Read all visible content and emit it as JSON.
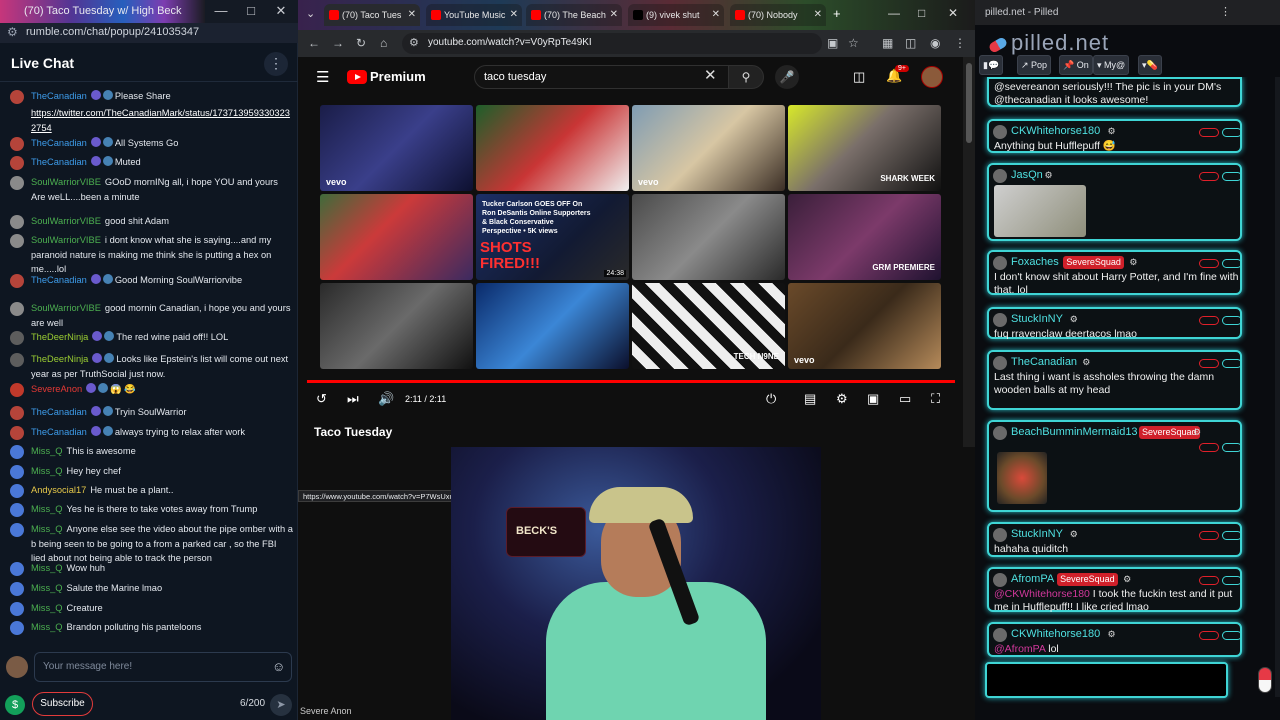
{
  "left_window": {
    "title": "(70) Taco Tuesday w/ High Beck",
    "url": "rumble.com/chat/popup/241035347",
    "header": "Live Chat",
    "messages": [
      {
        "user": "TheCanadian",
        "color": "#3d9be9",
        "text": "Please Share"
      },
      {
        "user": "",
        "color": "#ffffff",
        "text": "https://twitter.com/TheCanadianMark/status/1737139593303232754"
      },
      {
        "user": "TheCanadian",
        "color": "#3d9be9",
        "text": "All Systems Go"
      },
      {
        "user": "TheCanadian",
        "color": "#3d9be9",
        "text": "Muted"
      },
      {
        "user": "SoulWarriorVIBE",
        "color": "#4caf50",
        "text": "GOoD mornINg all, i hope YOU and yours Are weLL....been a minute"
      },
      {
        "user": "SoulWarriorVIBE",
        "color": "#4caf50",
        "text": "good shit Adam"
      },
      {
        "user": "SoulWarriorVIBE",
        "color": "#4caf50",
        "text": "i dont know what she is saying....and my paranoid nature is making me think she is putting a hex on me.....lol"
      },
      {
        "user": "TheCanadian",
        "color": "#3d9be9",
        "text": "Good Morning SoulWarriorvibe"
      },
      {
        "user": "SoulWarriorVIBE",
        "color": "#4caf50",
        "text": "good mornin Canadian, i hope you and yours are well"
      },
      {
        "user": "TheDeerNinja",
        "color": "#9acd32",
        "text": "The red wine paid off!! LOL"
      },
      {
        "user": "TheDeerNinja",
        "color": "#9acd32",
        "text": "Looks like Epstein's list will come out next year as per TruthSocial just now."
      },
      {
        "user": "SevereAnon",
        "color": "#e53935",
        "text": "😱 😂"
      },
      {
        "user": "TheCanadian",
        "color": "#3d9be9",
        "text": "Tryin SoulWarrior"
      },
      {
        "user": "TheCanadian",
        "color": "#3d9be9",
        "text": "always trying to relax after work"
      },
      {
        "user": "Miss_Q",
        "color": "#4caf50",
        "text": "This is awesome"
      },
      {
        "user": "Miss_Q",
        "color": "#4caf50",
        "text": "Hey hey chef"
      },
      {
        "user": "Andysocial17",
        "color": "#e6c84a",
        "text": "He must be a plant.."
      },
      {
        "user": "Miss_Q",
        "color": "#4caf50",
        "text": "Yes he is there to take votes away from Trump"
      },
      {
        "user": "Miss_Q",
        "color": "#4caf50",
        "text": "Anyone else see the video about the pipe omber with a b being seen to be going to a from a parked car , so the FBI lied about not being able to track the person"
      },
      {
        "user": "Miss_Q",
        "color": "#4caf50",
        "text": "Wow huh"
      },
      {
        "user": "Miss_Q",
        "color": "#4caf50",
        "text": "Salute the Marine lmao"
      },
      {
        "user": "Miss_Q",
        "color": "#4caf50",
        "text": "Creature"
      },
      {
        "user": "Miss_Q",
        "color": "#4caf50",
        "text": "Brandon polluting his panteloons"
      }
    ],
    "input_placeholder": "Your message here!",
    "subscribe": "Subscribe",
    "char_count": "6/200"
  },
  "browser": {
    "tabs": [
      {
        "label": "(70) Taco Tues",
        "fav": "#ff0000"
      },
      {
        "label": "YouTube Music",
        "fav": "#ff0000"
      },
      {
        "label": "(70) The Beach",
        "fav": "#ff0000"
      },
      {
        "label": "(9) vivek shut",
        "fav": "#000000"
      },
      {
        "label": "(70) Nobody",
        "fav": "#ff0000"
      }
    ],
    "url": "youtube.com/watch?v=V0yRpTe49KI",
    "yt": {
      "brand": "Premium",
      "search_query": "taco tuesday",
      "notif_count": "9+",
      "thumbs": [
        {
          "label": "vevo",
          "bg": "linear-gradient(135deg,#1a1d48,#3a3f8a 50%,#0d1030)"
        },
        {
          "label": "",
          "bg": "linear-gradient(135deg,#1d5f2a,#c93535 50%,#f0f0f0)"
        },
        {
          "label": "vevo",
          "bg": "linear-gradient(135deg,#7f9cb3,#d7c6a3 50%,#3b2e25)"
        },
        {
          "label": "SHARK WEEK",
          "bg": "linear-gradient(135deg,#d7e82a,#7a6f6a 45%,#111)"
        },
        {
          "label": "",
          "bg": "linear-gradient(135deg,#3f6b3a,#cb3a3a 40%,#3b2a60)"
        },
        {
          "label": "Tucker Carlson GOES OFF On Ron DeSantis Online Supporters & Black Conservative Perspective • 5K views",
          "title2": "SHOTS FIRED!!!",
          "dur": "24:38",
          "bg": "linear-gradient(135deg,#1c2f66,#121a33 60%,#2a2a2a)"
        },
        {
          "label": "",
          "bg": "linear-gradient(135deg,#4a4a4a,#8a8a8a 50%,#2a2a2a)"
        },
        {
          "label": "GRM PREMIERE",
          "bg": "linear-gradient(135deg,#3a1f3a,#7c3a6a 50%,#1f1230)"
        },
        {
          "label": "",
          "bg": "linear-gradient(135deg,#2a2a2a,#6a6a6a 50%,#111)"
        },
        {
          "label": "",
          "bg": "linear-gradient(135deg,#0a2a6a,#3b86d6 50%,#0b0f2b)"
        },
        {
          "label": "TECH N9NE",
          "bg": "repeating-linear-gradient(45deg,#111 0 10px,#eee 10px 20px)"
        },
        {
          "label": "vevo",
          "bg": "linear-gradient(135deg,#6a4a2a,#3a2a1a 50%,#b58a5a)"
        }
      ],
      "time": "2:11 / 2:11",
      "video_title": "Taco Tuesday",
      "hover_url": "https://www.youtube.com/watch?v=P7WsUxuvCvk"
    },
    "webcam_user": "Severe Anon"
  },
  "right_window": {
    "title": "pilled.net - Pilled",
    "logo": "pilled.net",
    "tools": [
      "Pop",
      "On",
      "My@"
    ],
    "cards": [
      {
        "user": "",
        "body_mention": "",
        "body": "@severeanon seriously!!! The pic is in your DM's @thecanadian it looks awesome!"
      },
      {
        "user": "CKWhitehorse180",
        "body": "Anything but Hufflepuff 😅"
      },
      {
        "user": "JasQn",
        "body": ""
      },
      {
        "user": "Foxaches",
        "tag": "SevereSquad",
        "body": "I don't know shit about Harry Potter, and I'm fine with that. lol"
      },
      {
        "user": "StuckInNY",
        "body": "fuq rravenclaw deertacos lmao"
      },
      {
        "user": "TheCanadian",
        "body": "Last thing i want is assholes throwing the damn wooden balls at my head"
      },
      {
        "user": "BeachBumminMermaid13",
        "tag": "SevereSquad",
        "body": ""
      },
      {
        "user": "StuckInNY",
        "body": "hahaha quiditch"
      },
      {
        "user": "AfromPA",
        "tag": "SevereSquad",
        "mention": "@CKWhitehorse180",
        "body": " I took the fuckin test and it put me in Hufflepuff!! I like cried lmao"
      },
      {
        "user": "CKWhitehorse180",
        "mention": "@AfromPA",
        "body": " lol"
      }
    ]
  }
}
